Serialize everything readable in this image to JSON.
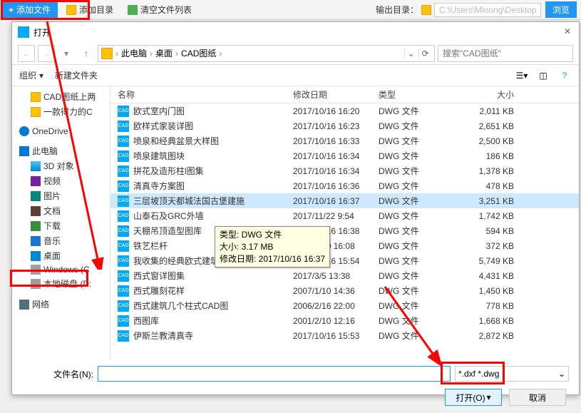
{
  "topbar": {
    "add_file": "添加文件",
    "add_dir": "添加目录",
    "clear_list": "清空文件列表",
    "output_label": "输出目录：",
    "output_path": "C:\\Users\\Mloong\\Desktop",
    "browse": "浏览"
  },
  "dialog": {
    "title": "打开",
    "breadcrumb": [
      "此电脑",
      "桌面",
      "CAD图纸"
    ],
    "search_placeholder": "搜索\"CAD图纸\"",
    "organize": "组织",
    "new_folder": "新建文件夹"
  },
  "tree": [
    {
      "level": 1,
      "icon": "ti-folder",
      "label": "CAD图纸上两"
    },
    {
      "level": 1,
      "icon": "ti-folder",
      "label": "一款得力的C"
    },
    {
      "level": 0,
      "icon": "ti-onedrive",
      "label": "OneDrive",
      "gap": true
    },
    {
      "level": 0,
      "icon": "ti-pc",
      "label": "此电脑",
      "gap": true
    },
    {
      "level": 1,
      "icon": "ti-3d",
      "label": "3D 对象"
    },
    {
      "level": 1,
      "icon": "ti-video",
      "label": "视频"
    },
    {
      "level": 1,
      "icon": "ti-pic",
      "label": "图片"
    },
    {
      "level": 1,
      "icon": "ti-doc",
      "label": "文档"
    },
    {
      "level": 1,
      "icon": "ti-dl",
      "label": "下载"
    },
    {
      "level": 1,
      "icon": "ti-music",
      "label": "音乐"
    },
    {
      "level": 1,
      "icon": "ti-desk",
      "label": "桌面"
    },
    {
      "level": 1,
      "icon": "ti-disk",
      "label": "Windows (C"
    },
    {
      "level": 1,
      "icon": "ti-disk",
      "label": "本地磁盘 (D:"
    },
    {
      "level": 0,
      "icon": "ti-net",
      "label": "网络",
      "gap": true
    }
  ],
  "columns": {
    "name": "名称",
    "date": "修改日期",
    "type": "类型",
    "size": "大小"
  },
  "files": [
    {
      "name": "欧式室内门图",
      "date": "2017/10/16 16:20",
      "type": "DWG 文件",
      "size": "2,011 KB"
    },
    {
      "name": "欧样式家装详图",
      "date": "2017/10/16 16:23",
      "type": "DWG 文件",
      "size": "2,651 KB"
    },
    {
      "name": "喷泉和经典盆景大样图",
      "date": "2017/10/16 16:33",
      "type": "DWG 文件",
      "size": "2,500 KB"
    },
    {
      "name": "喷泉建筑图块",
      "date": "2017/10/16 16:34",
      "type": "DWG 文件",
      "size": "186 KB"
    },
    {
      "name": "拼花及造形柱l图集",
      "date": "2017/10/16 16:34",
      "type": "DWG 文件",
      "size": "1,378 KB"
    },
    {
      "name": "清真寺方案图",
      "date": "2017/10/16 16:36",
      "type": "DWG 文件",
      "size": "478 KB"
    },
    {
      "name": "三层坡顶天都城法国古堡建施",
      "date": "2017/10/16 16:37",
      "type": "DWG 文件",
      "size": "3,251 KB",
      "selected": true
    },
    {
      "name": "山泰石及GRC外墙",
      "date": "2017/11/22 9:54",
      "type": "DWG 文件",
      "size": "1,742 KB"
    },
    {
      "name": "天棚吊顶造型图库",
      "date": "2017/10/16 16:38",
      "type": "DWG 文件",
      "size": "594 KB"
    },
    {
      "name": "铁艺栏杆",
      "date": "2006/6/20 16:08",
      "type": "DWG 文件",
      "size": "372 KB"
    },
    {
      "name": "我收集的经典欧式建筑立面",
      "date": "2017/10/16 15:54",
      "type": "DWG 文件",
      "size": "5,749 KB"
    },
    {
      "name": "西式窗详图集",
      "date": "2017/3/5 13:38",
      "type": "DWG 文件",
      "size": "4,431 KB"
    },
    {
      "name": "西式雕刻花样",
      "date": "2007/1/10 14:36",
      "type": "DWG 文件",
      "size": "1,450 KB"
    },
    {
      "name": "西式建筑几个柱式CAD图",
      "date": "2006/2/16 22:00",
      "type": "DWG 文件",
      "size": "778 KB"
    },
    {
      "name": "西图库",
      "date": "2001/2/10 12:16",
      "type": "DWG 文件",
      "size": "1,668 KB"
    },
    {
      "name": "伊斯兰教清真寺",
      "date": "2017/10/16 15:53",
      "type": "DWG 文件",
      "size": "2,872 KB"
    }
  ],
  "tooltip": {
    "l1": "类型: DWG 文件",
    "l2": "大小: 3.17 MB",
    "l3": "修改日期: 2017/10/16 16:37"
  },
  "bottom": {
    "filename_label": "文件名(N):",
    "filter": "*.dxf *.dwg",
    "open": "打开(O)",
    "cancel": "取消"
  }
}
